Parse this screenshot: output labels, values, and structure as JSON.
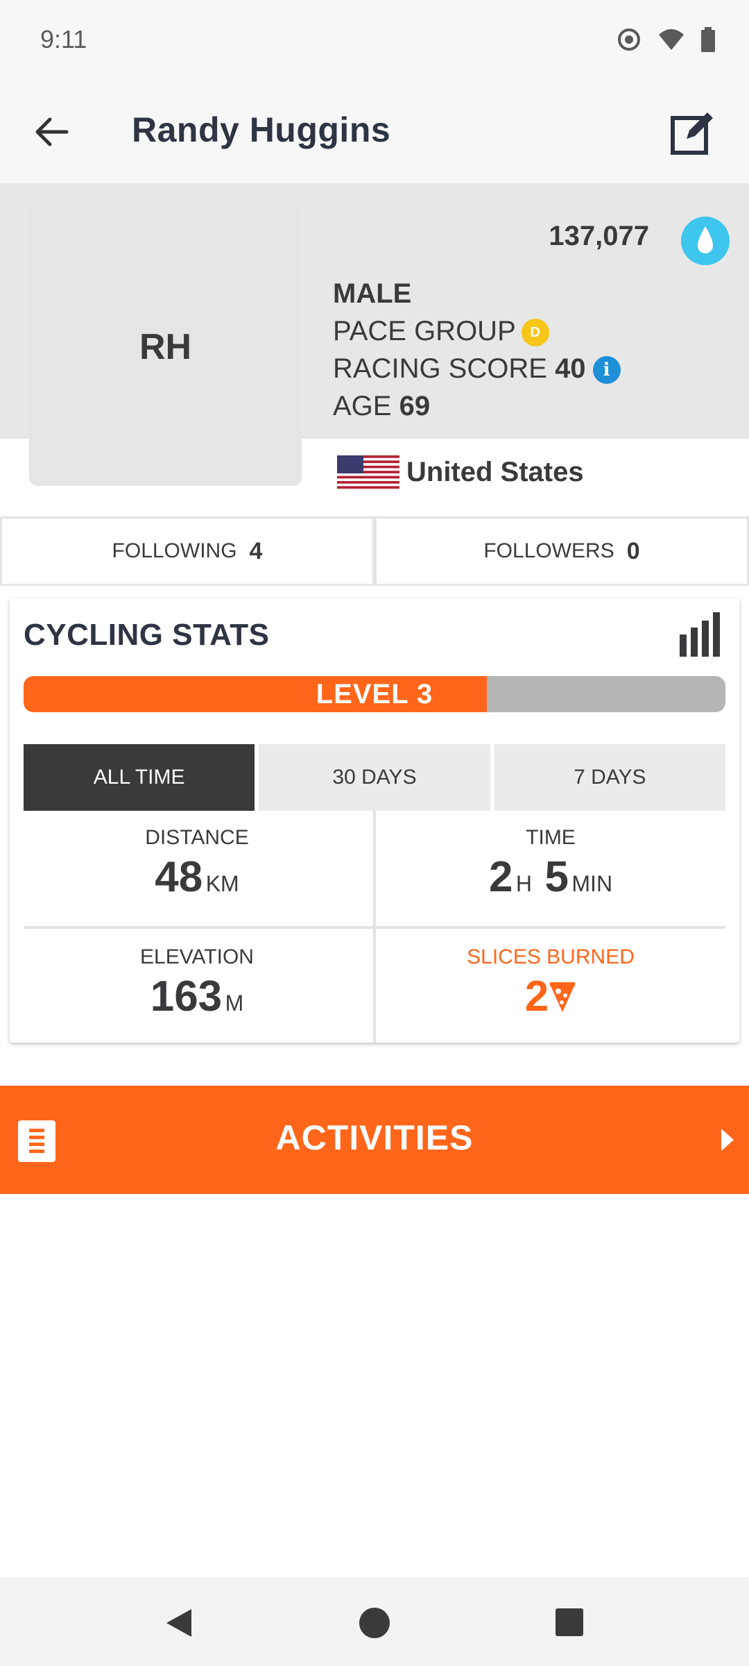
{
  "status_bar": {
    "time": "9:11"
  },
  "app_bar": {
    "title": "Randy Huggins"
  },
  "profile": {
    "initials": "RH",
    "drops": "137,077",
    "gender": "MALE",
    "pace_group_label": "PACE GROUP",
    "pace_group_badge": "D",
    "racing_score_label": "RACING SCORE",
    "racing_score_value": "40",
    "age_label": "AGE",
    "age_value": "69",
    "country": "United States"
  },
  "social": {
    "following_label": "FOLLOWING",
    "following_count": "4",
    "followers_label": "FOLLOWERS",
    "followers_count": "0"
  },
  "cycling_stats": {
    "title": "CYCLING STATS",
    "level_label": "LEVEL 3",
    "level_progress": 0.66,
    "tabs": [
      "ALL TIME",
      "30 DAYS",
      "7 DAYS"
    ],
    "active_tab": "ALL TIME",
    "distance_label": "DISTANCE",
    "distance_value": "48",
    "distance_unit": "KM",
    "time_label": "TIME",
    "time_hours": "2",
    "time_hours_unit": "H",
    "time_minutes": "5",
    "time_minutes_unit": "MIN",
    "elevation_label": "ELEVATION",
    "elevation_value": "163",
    "elevation_unit": "M",
    "slices_label": "SLICES BURNED",
    "slices_value": "2"
  },
  "activities": {
    "label": "ACTIVITIES"
  },
  "colors": {
    "accent": "#ff661a",
    "drop": "#3ec6ee",
    "pace_d": "#f6c619",
    "info": "#1f8fd6"
  },
  "icons": [
    "back-arrow-icon",
    "edit-icon",
    "water-drop-icon",
    "info-icon",
    "us-flag-icon",
    "bar-chart-icon",
    "pizza-icon",
    "list-icon",
    "chevron-right-icon",
    "nav-back-icon",
    "nav-home-icon",
    "nav-recents-icon"
  ]
}
